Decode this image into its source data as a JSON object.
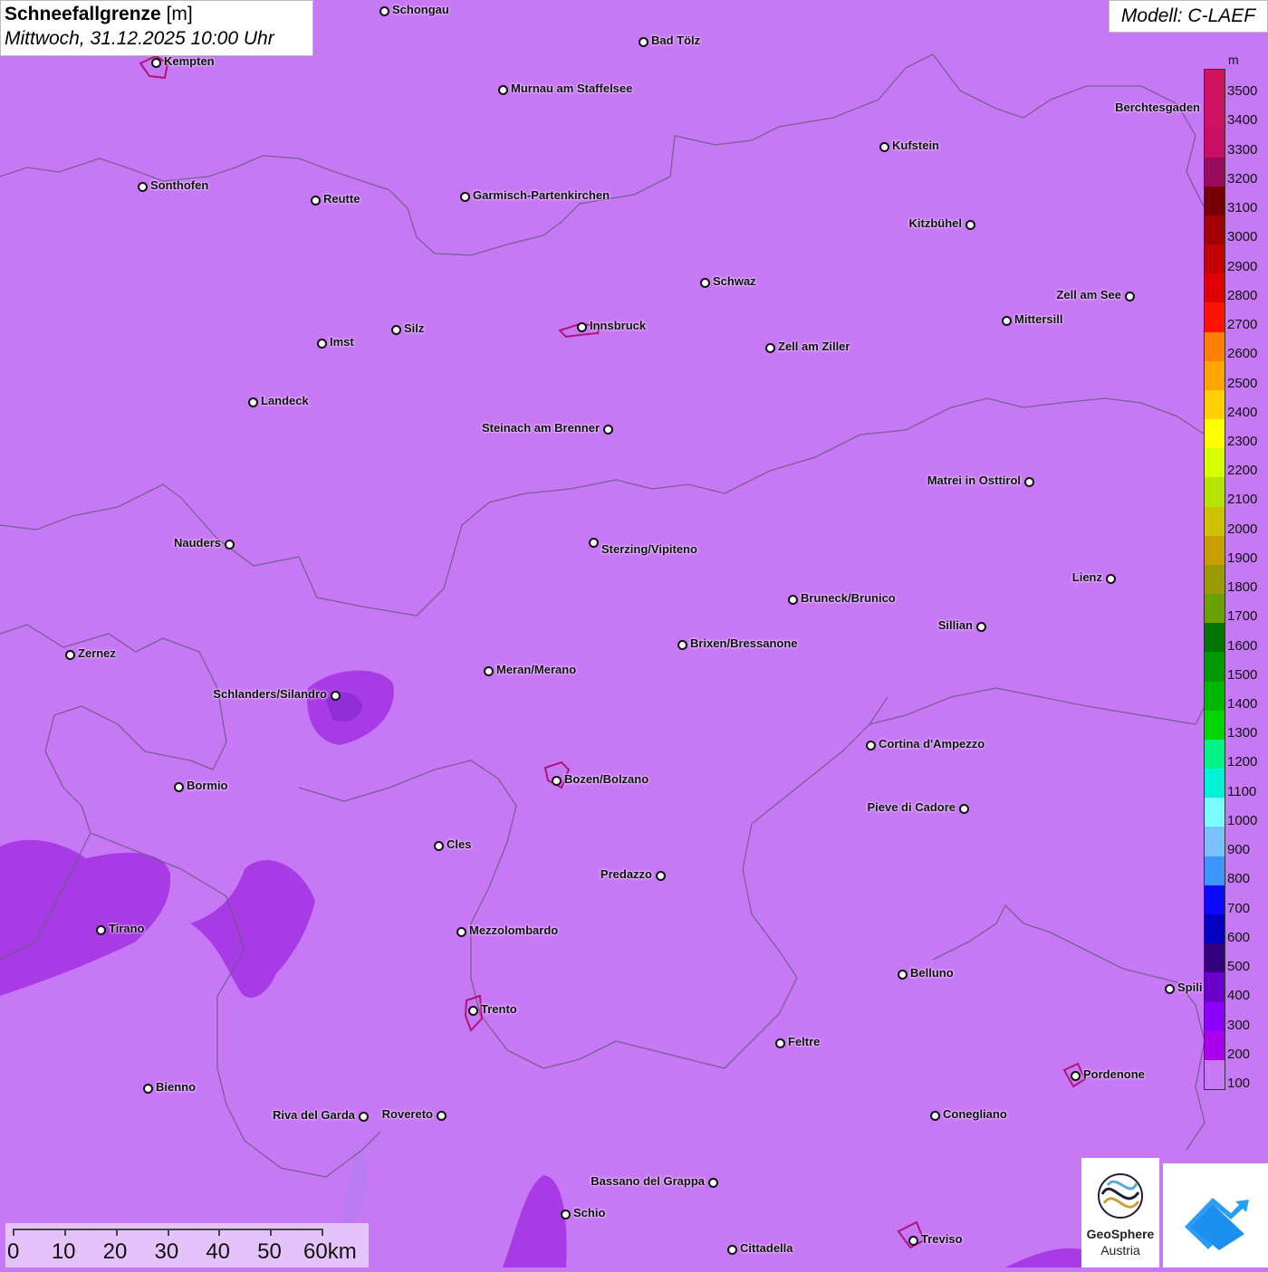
{
  "title": {
    "main": "Schneefallgrenze",
    "unit": "[m]",
    "datetime": "Mittwoch, 31.12.2025 10:00 Uhr"
  },
  "model": "Modell: C-LAEF",
  "legend": {
    "unit": "m",
    "levels": [
      {
        "label": "3500",
        "color": "#d2135f"
      },
      {
        "label": "3400",
        "color": "#d01264"
      },
      {
        "label": "3300",
        "color": "#c80f63"
      },
      {
        "label": "3200",
        "color": "#9b0b5c"
      },
      {
        "label": "3100",
        "color": "#760003"
      },
      {
        "label": "3000",
        "color": "#a30101"
      },
      {
        "label": "2900",
        "color": "#c20202"
      },
      {
        "label": "2800",
        "color": "#e00000"
      },
      {
        "label": "2700",
        "color": "#ff1300"
      },
      {
        "label": "2600",
        "color": "#ff7f00"
      },
      {
        "label": "2500",
        "color": "#ffa400"
      },
      {
        "label": "2400",
        "color": "#ffd000"
      },
      {
        "label": "2300",
        "color": "#ffff00"
      },
      {
        "label": "2200",
        "color": "#d8ff00"
      },
      {
        "label": "2100",
        "color": "#b4e400"
      },
      {
        "label": "2000",
        "color": "#cdc100"
      },
      {
        "label": "1900",
        "color": "#c79f00"
      },
      {
        "label": "1800",
        "color": "#999b00"
      },
      {
        "label": "1700",
        "color": "#6ba100"
      },
      {
        "label": "1600",
        "color": "#007400"
      },
      {
        "label": "1500",
        "color": "#009800"
      },
      {
        "label": "1400",
        "color": "#00b700"
      },
      {
        "label": "1300",
        "color": "#00d700"
      },
      {
        "label": "1200",
        "color": "#00f384"
      },
      {
        "label": "1100",
        "color": "#00f2d4"
      },
      {
        "label": "1000",
        "color": "#7affff"
      },
      {
        "label": "900",
        "color": "#7ac2ff"
      },
      {
        "label": "800",
        "color": "#3d95ff"
      },
      {
        "label": "700",
        "color": "#0a0aff"
      },
      {
        "label": "600",
        "color": "#0000c3"
      },
      {
        "label": "500",
        "color": "#330080"
      },
      {
        "label": "400",
        "color": "#6a00cc"
      },
      {
        "label": "300",
        "color": "#8b00ff"
      },
      {
        "label": "200",
        "color": "#aa00ee"
      },
      {
        "label": "100",
        "color": "#c779f5"
      }
    ]
  },
  "cities": [
    {
      "name": "Schongau"
    },
    {
      "name": "Bad Tölz"
    },
    {
      "name": "Kempten"
    },
    {
      "name": "Murnau am Staffelsee"
    },
    {
      "name": "Berchtesgaden"
    },
    {
      "name": "Kufstein"
    },
    {
      "name": "Sonthofen"
    },
    {
      "name": "Reutte"
    },
    {
      "name": "Garmisch-Partenkirchen"
    },
    {
      "name": "Kitzbühel"
    },
    {
      "name": "Schwaz"
    },
    {
      "name": "Zell am See"
    },
    {
      "name": "Innsbruck"
    },
    {
      "name": "Mittersill"
    },
    {
      "name": "Imst"
    },
    {
      "name": "Silz"
    },
    {
      "name": "Zell am Ziller"
    },
    {
      "name": "Landeck"
    },
    {
      "name": "Steinach am Brenner"
    },
    {
      "name": "Matrei in Osttirol"
    },
    {
      "name": "Nauders"
    },
    {
      "name": "Sterzing/Vipiteno"
    },
    {
      "name": "Lienz"
    },
    {
      "name": "Bruneck/Brunico"
    },
    {
      "name": "Sillian"
    },
    {
      "name": "Brixen/Bressanone"
    },
    {
      "name": "Zernez"
    },
    {
      "name": "Meran/Merano"
    },
    {
      "name": "Schlanders/Silandro"
    },
    {
      "name": "Cortina d'Ampezzo"
    },
    {
      "name": "Bozen/Bolzano"
    },
    {
      "name": "Bormio"
    },
    {
      "name": "Pieve di Cadore"
    },
    {
      "name": "Cles"
    },
    {
      "name": "Predazzo"
    },
    {
      "name": "Tirano"
    },
    {
      "name": "Mezzolombardo"
    },
    {
      "name": "Belluno"
    },
    {
      "name": "Spili"
    },
    {
      "name": "Trento"
    },
    {
      "name": "Feltre"
    },
    {
      "name": "Pordenone"
    },
    {
      "name": "Bienno"
    },
    {
      "name": "Riva del Garda"
    },
    {
      "name": "Rovereto"
    },
    {
      "name": "Conegliano"
    },
    {
      "name": "Bassano del Grappa"
    },
    {
      "name": "Schio"
    },
    {
      "name": "Treviso"
    },
    {
      "name": "Cittadella"
    }
  ],
  "scale": {
    "labels": [
      "0",
      "10",
      "20",
      "30",
      "40",
      "50",
      "60km"
    ]
  },
  "logo": {
    "name": "GeoSphere",
    "sub": "Austria"
  },
  "app_icon": "cloud-arrow-icon"
}
